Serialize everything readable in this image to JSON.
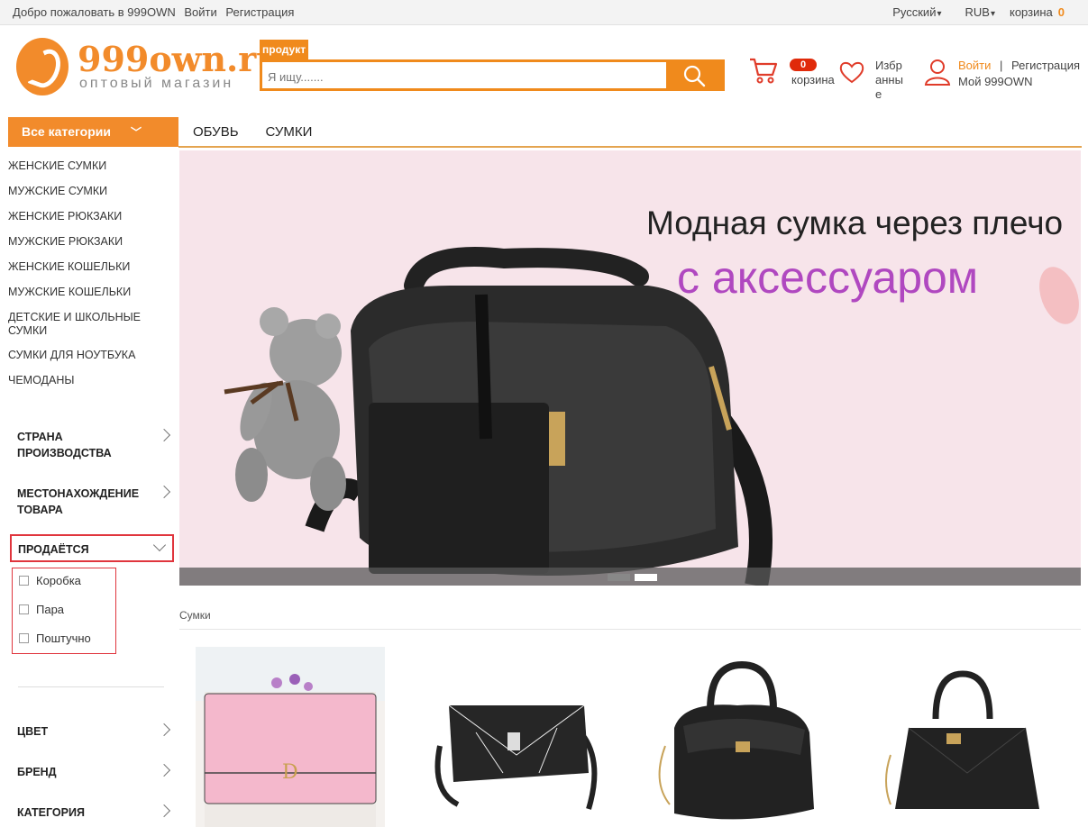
{
  "topbar": {
    "welcome": "Добро пожаловать в 999OWN",
    "login": "Войти",
    "register": "Регистрация",
    "language": "Русский",
    "currency": "RUB",
    "cart_label": "корзина",
    "cart_count": "0"
  },
  "logo": {
    "name": "999own.ru",
    "tagline": "оптовый магазин"
  },
  "search": {
    "tag": "продукт",
    "placeholder": "Я ищу......."
  },
  "header": {
    "cart_count": "0",
    "cart_label": "корзина",
    "favorites_label": "Избранные",
    "login": "Войти",
    "divider": "|",
    "register": "Регистрация",
    "my_account": "Мой 999OWN"
  },
  "nav": {
    "all_categories": "Все категории",
    "links": [
      "ОБУВЬ",
      "СУМКИ"
    ]
  },
  "categories": [
    "ЖЕНСКИЕ СУМКИ",
    "МУЖСКИЕ СУМКИ",
    "ЖЕНСКИЕ РЮКЗАКИ",
    "МУЖСКИЕ РЮКЗАКИ",
    "ЖЕНСКИЕ КОШЕЛЬКИ",
    "МУЖСКИЕ КОШЕЛЬКИ",
    "ДЕТСКИЕ И ШКОЛЬНЫЕ СУМКИ",
    "СУМКИ ДЛЯ НОУТБУКА",
    "ЧЕМОДАНЫ"
  ],
  "filters": {
    "country": "СТРАНА ПРОИЗВОДСТВА",
    "location": "МЕСТОНАХОЖДЕНИЕ ТОВАРА",
    "sold": "ПРОДАЁТСЯ",
    "sold_options": [
      "Коробка",
      "Пара",
      "Поштучно"
    ],
    "color": "ЦВЕТ",
    "brand": "БРЕНД",
    "category": "КАТЕГОРИЯ"
  },
  "banner": {
    "line1": "Модная сумка через плечо",
    "line2": "с аксессуаром"
  },
  "breadcrumb": "Сумки",
  "colors": {
    "accent": "#f28b2b",
    "highlight": "#e0353d",
    "banner_text": "#b048c0"
  }
}
